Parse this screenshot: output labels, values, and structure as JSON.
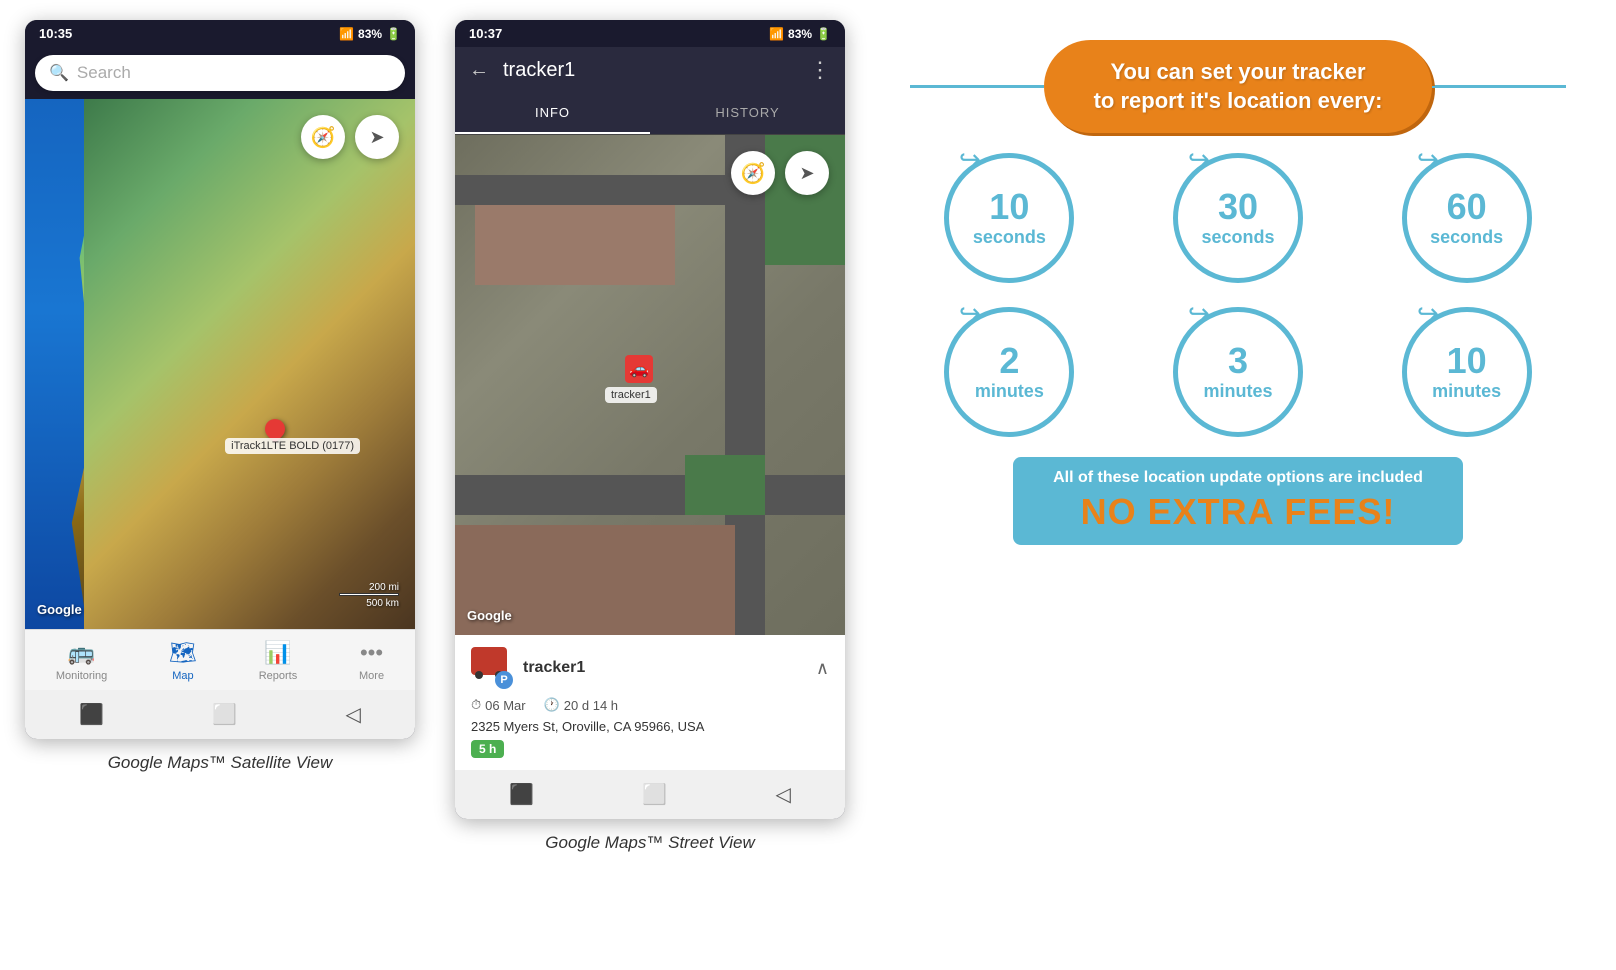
{
  "phone1": {
    "status": {
      "time": "10:35",
      "signal": "📶",
      "battery": "83%"
    },
    "search_placeholder": "Search",
    "map": {
      "tracker_label": "iTrack1LTE BOLD (0177)",
      "google_label": "Google",
      "scale_label1": "200 mi",
      "scale_label2": "500 km"
    },
    "nav_items": [
      {
        "icon": "🚌",
        "label": "Monitoring",
        "active": false
      },
      {
        "icon": "🗺",
        "label": "Map",
        "active": true
      },
      {
        "icon": "📊",
        "label": "Reports",
        "active": false
      },
      {
        "icon": "•••",
        "label": "More",
        "active": false
      }
    ],
    "caption": "Google Maps™ Satellite View"
  },
  "phone2": {
    "status": {
      "time": "10:37",
      "signal": "📶",
      "battery": "83%"
    },
    "tracker_name": "tracker1",
    "tabs": [
      {
        "label": "INFO",
        "active": true
      },
      {
        "label": "HISTORY",
        "active": false
      }
    ],
    "map": {
      "tracker1_label": "tracker1",
      "google_label": "Google"
    },
    "info_panel": {
      "tracker_name": "tracker1",
      "date": "06 Mar",
      "duration": "20 d 14 h",
      "address": "2325 Myers St, Oroville, CA 95966, USA",
      "hours_badge": "5 h"
    },
    "caption": "Google Maps™ Street View"
  },
  "info_graphic": {
    "headline_line1": "You can set your tracker",
    "headline_line2": "to report it's location every:",
    "intervals": [
      {
        "number": "10",
        "unit": "seconds"
      },
      {
        "number": "30",
        "unit": "seconds"
      },
      {
        "number": "60",
        "unit": "seconds"
      },
      {
        "number": "2",
        "unit": "minutes"
      },
      {
        "number": "3",
        "unit": "minutes"
      },
      {
        "number": "10",
        "unit": "minutes"
      }
    ],
    "included_text": "All of these location update options are included",
    "no_fees_label": "NO EXTRA FEES!"
  }
}
